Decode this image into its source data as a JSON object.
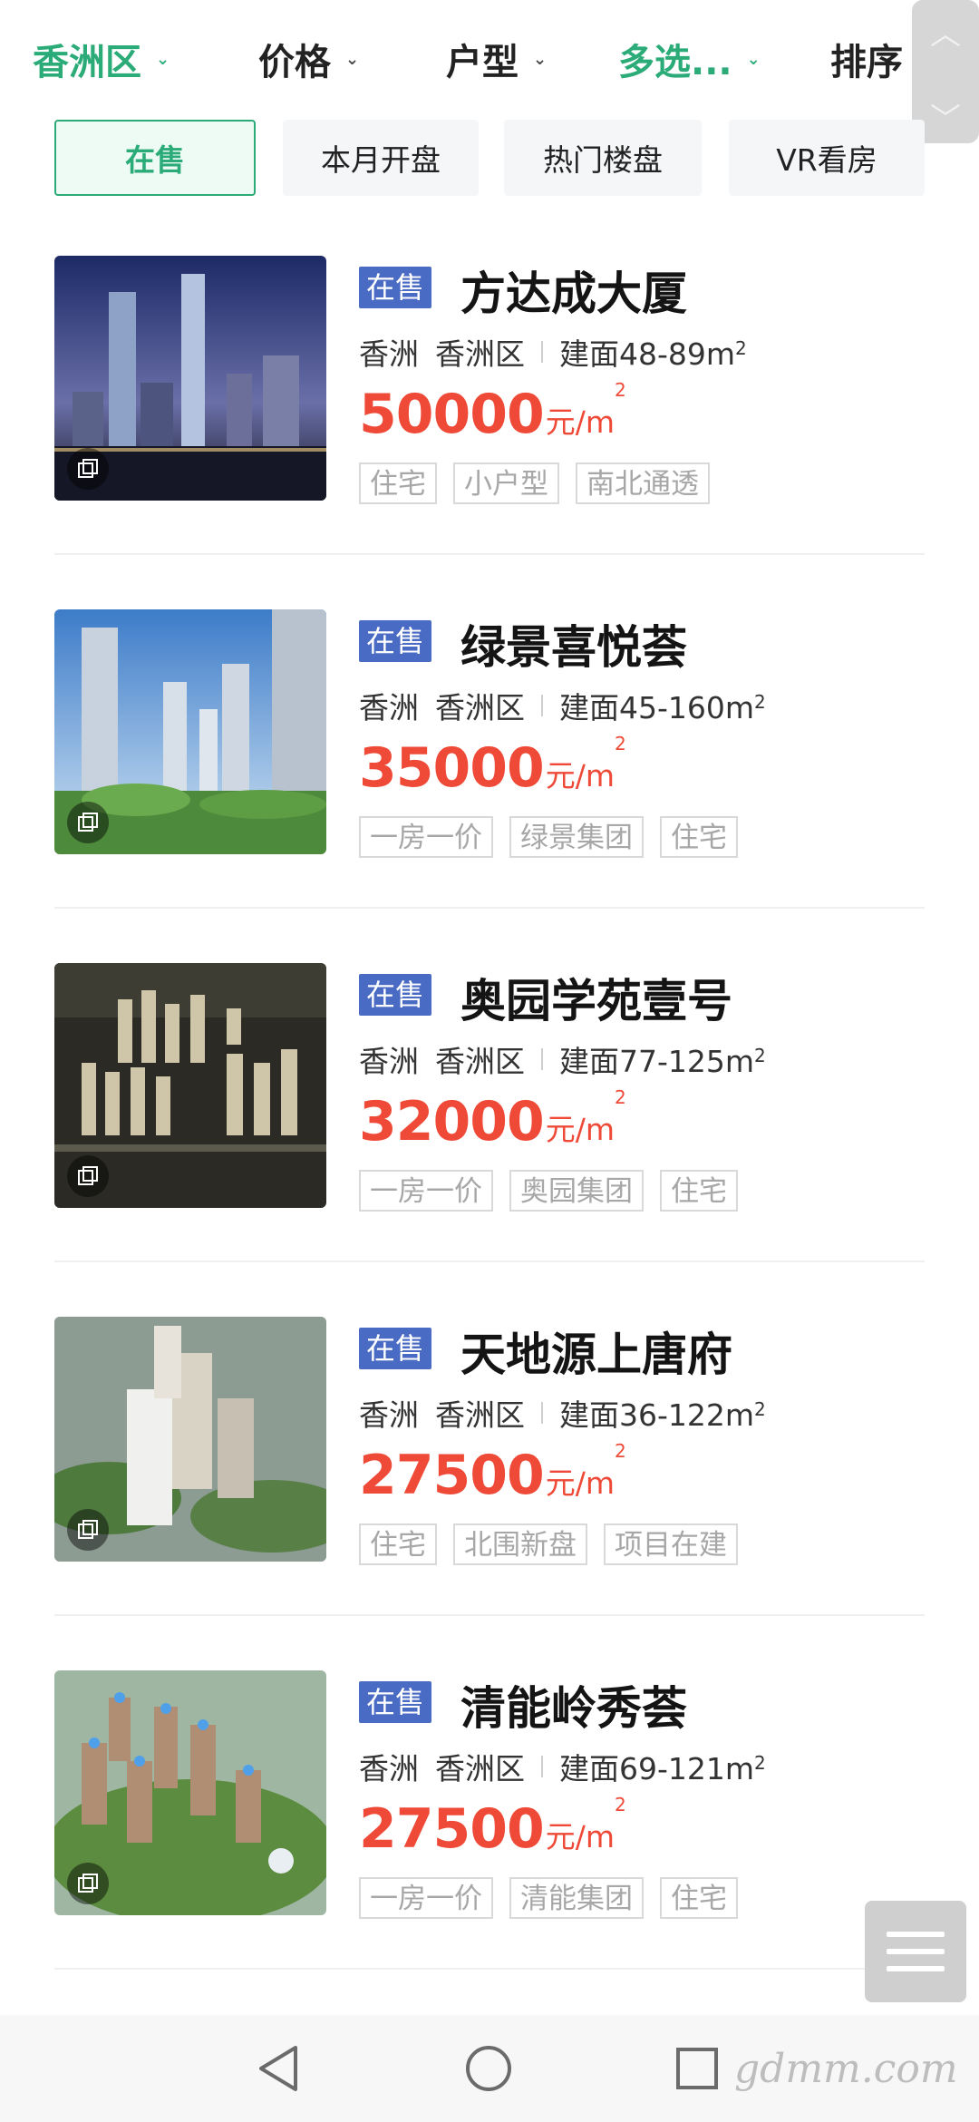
{
  "filters": {
    "district": {
      "label": "香洲区"
    },
    "price": {
      "label": "价格"
    },
    "layout": {
      "label": "户型"
    },
    "multi": {
      "label": "多选..."
    },
    "sort": {
      "label": "排序"
    }
  },
  "tabs": [
    {
      "label": "在售",
      "active": true
    },
    {
      "label": "本月开盘",
      "active": false
    },
    {
      "label": "热门楼盘",
      "active": false
    },
    {
      "label": "VR看房",
      "active": false
    }
  ],
  "listings": [
    {
      "status": "在售",
      "name": "方达成大厦",
      "city": "香洲",
      "district": "香洲区",
      "area": "建面48-89m",
      "price": "50000",
      "unit": "元/m",
      "tags": [
        "住宅",
        "小户型",
        "南北通透"
      ]
    },
    {
      "status": "在售",
      "name": "绿景喜悦荟",
      "city": "香洲",
      "district": "香洲区",
      "area": "建面45-160m",
      "price": "35000",
      "unit": "元/m",
      "tags": [
        "一房一价",
        "绿景集团",
        "住宅"
      ]
    },
    {
      "status": "在售",
      "name": "奥园学苑壹号",
      "city": "香洲",
      "district": "香洲区",
      "area": "建面77-125m",
      "price": "32000",
      "unit": "元/m",
      "tags": [
        "一房一价",
        "奥园集团",
        "住宅"
      ]
    },
    {
      "status": "在售",
      "name": "天地源上唐府",
      "city": "香洲",
      "district": "香洲区",
      "area": "建面36-122m",
      "price": "27500",
      "unit": "元/m",
      "tags": [
        "住宅",
        "北围新盘",
        "项目在建"
      ]
    },
    {
      "status": "在售",
      "name": "清能岭秀荟",
      "city": "香洲",
      "district": "香洲区",
      "area": "建面69-121m",
      "price": "27500",
      "unit": "元/m",
      "tags": [
        "一房一价",
        "清能集团",
        "住宅"
      ]
    }
  ],
  "area_sup": "2",
  "watermark": "gdmm.com",
  "colors": {
    "accent": "#2aab77",
    "price": "#ef4a37",
    "status_badge": "#4a6bc4"
  }
}
